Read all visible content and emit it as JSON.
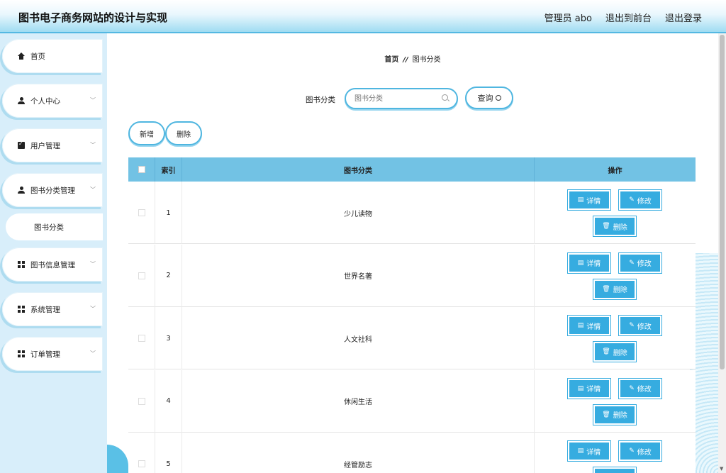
{
  "header": {
    "title": "图书电子商务网站的设计与实现",
    "user": "管理员 abo",
    "to_front": "退出到前台",
    "logout": "退出登录"
  },
  "sidebar": {
    "items": [
      {
        "label": "首页",
        "icon": "home-icon",
        "arrow": false
      },
      {
        "label": "个人中心",
        "icon": "user-icon",
        "arrow": true
      },
      {
        "label": "用户管理",
        "icon": "clipboard-icon",
        "arrow": true
      },
      {
        "label": "图书分类管理",
        "icon": "user-icon",
        "arrow": true
      },
      {
        "label": "图书信息管理",
        "icon": "grid-icon",
        "arrow": true
      },
      {
        "label": "系统管理",
        "icon": "grid-icon",
        "arrow": true
      },
      {
        "label": "订单管理",
        "icon": "grid-icon",
        "arrow": true
      }
    ],
    "submenu": {
      "label": "图书分类"
    }
  },
  "breadcrumb": {
    "home": "首页",
    "sep": "//",
    "current": "图书分类"
  },
  "search": {
    "label": "图书分类",
    "placeholder": "图书分类",
    "query_button": "查询"
  },
  "toolbar": {
    "add": "新增",
    "delete": "删除"
  },
  "table": {
    "columns": {
      "index": "索引",
      "category": "图书分类",
      "actions": "操作"
    },
    "rows": [
      {
        "index": "1",
        "category": "少儿读物"
      },
      {
        "index": "2",
        "category": "世界名著"
      },
      {
        "index": "3",
        "category": "人文社科"
      },
      {
        "index": "4",
        "category": "休闲生活"
      },
      {
        "index": "5",
        "category": "经管励志"
      }
    ],
    "actions": {
      "detail": "详情",
      "edit": "修改",
      "delete": "删除"
    }
  },
  "colors": {
    "accent": "#36ace0",
    "header_bg": "#72c2e4",
    "sidebar_bg": "#d8eefa"
  }
}
